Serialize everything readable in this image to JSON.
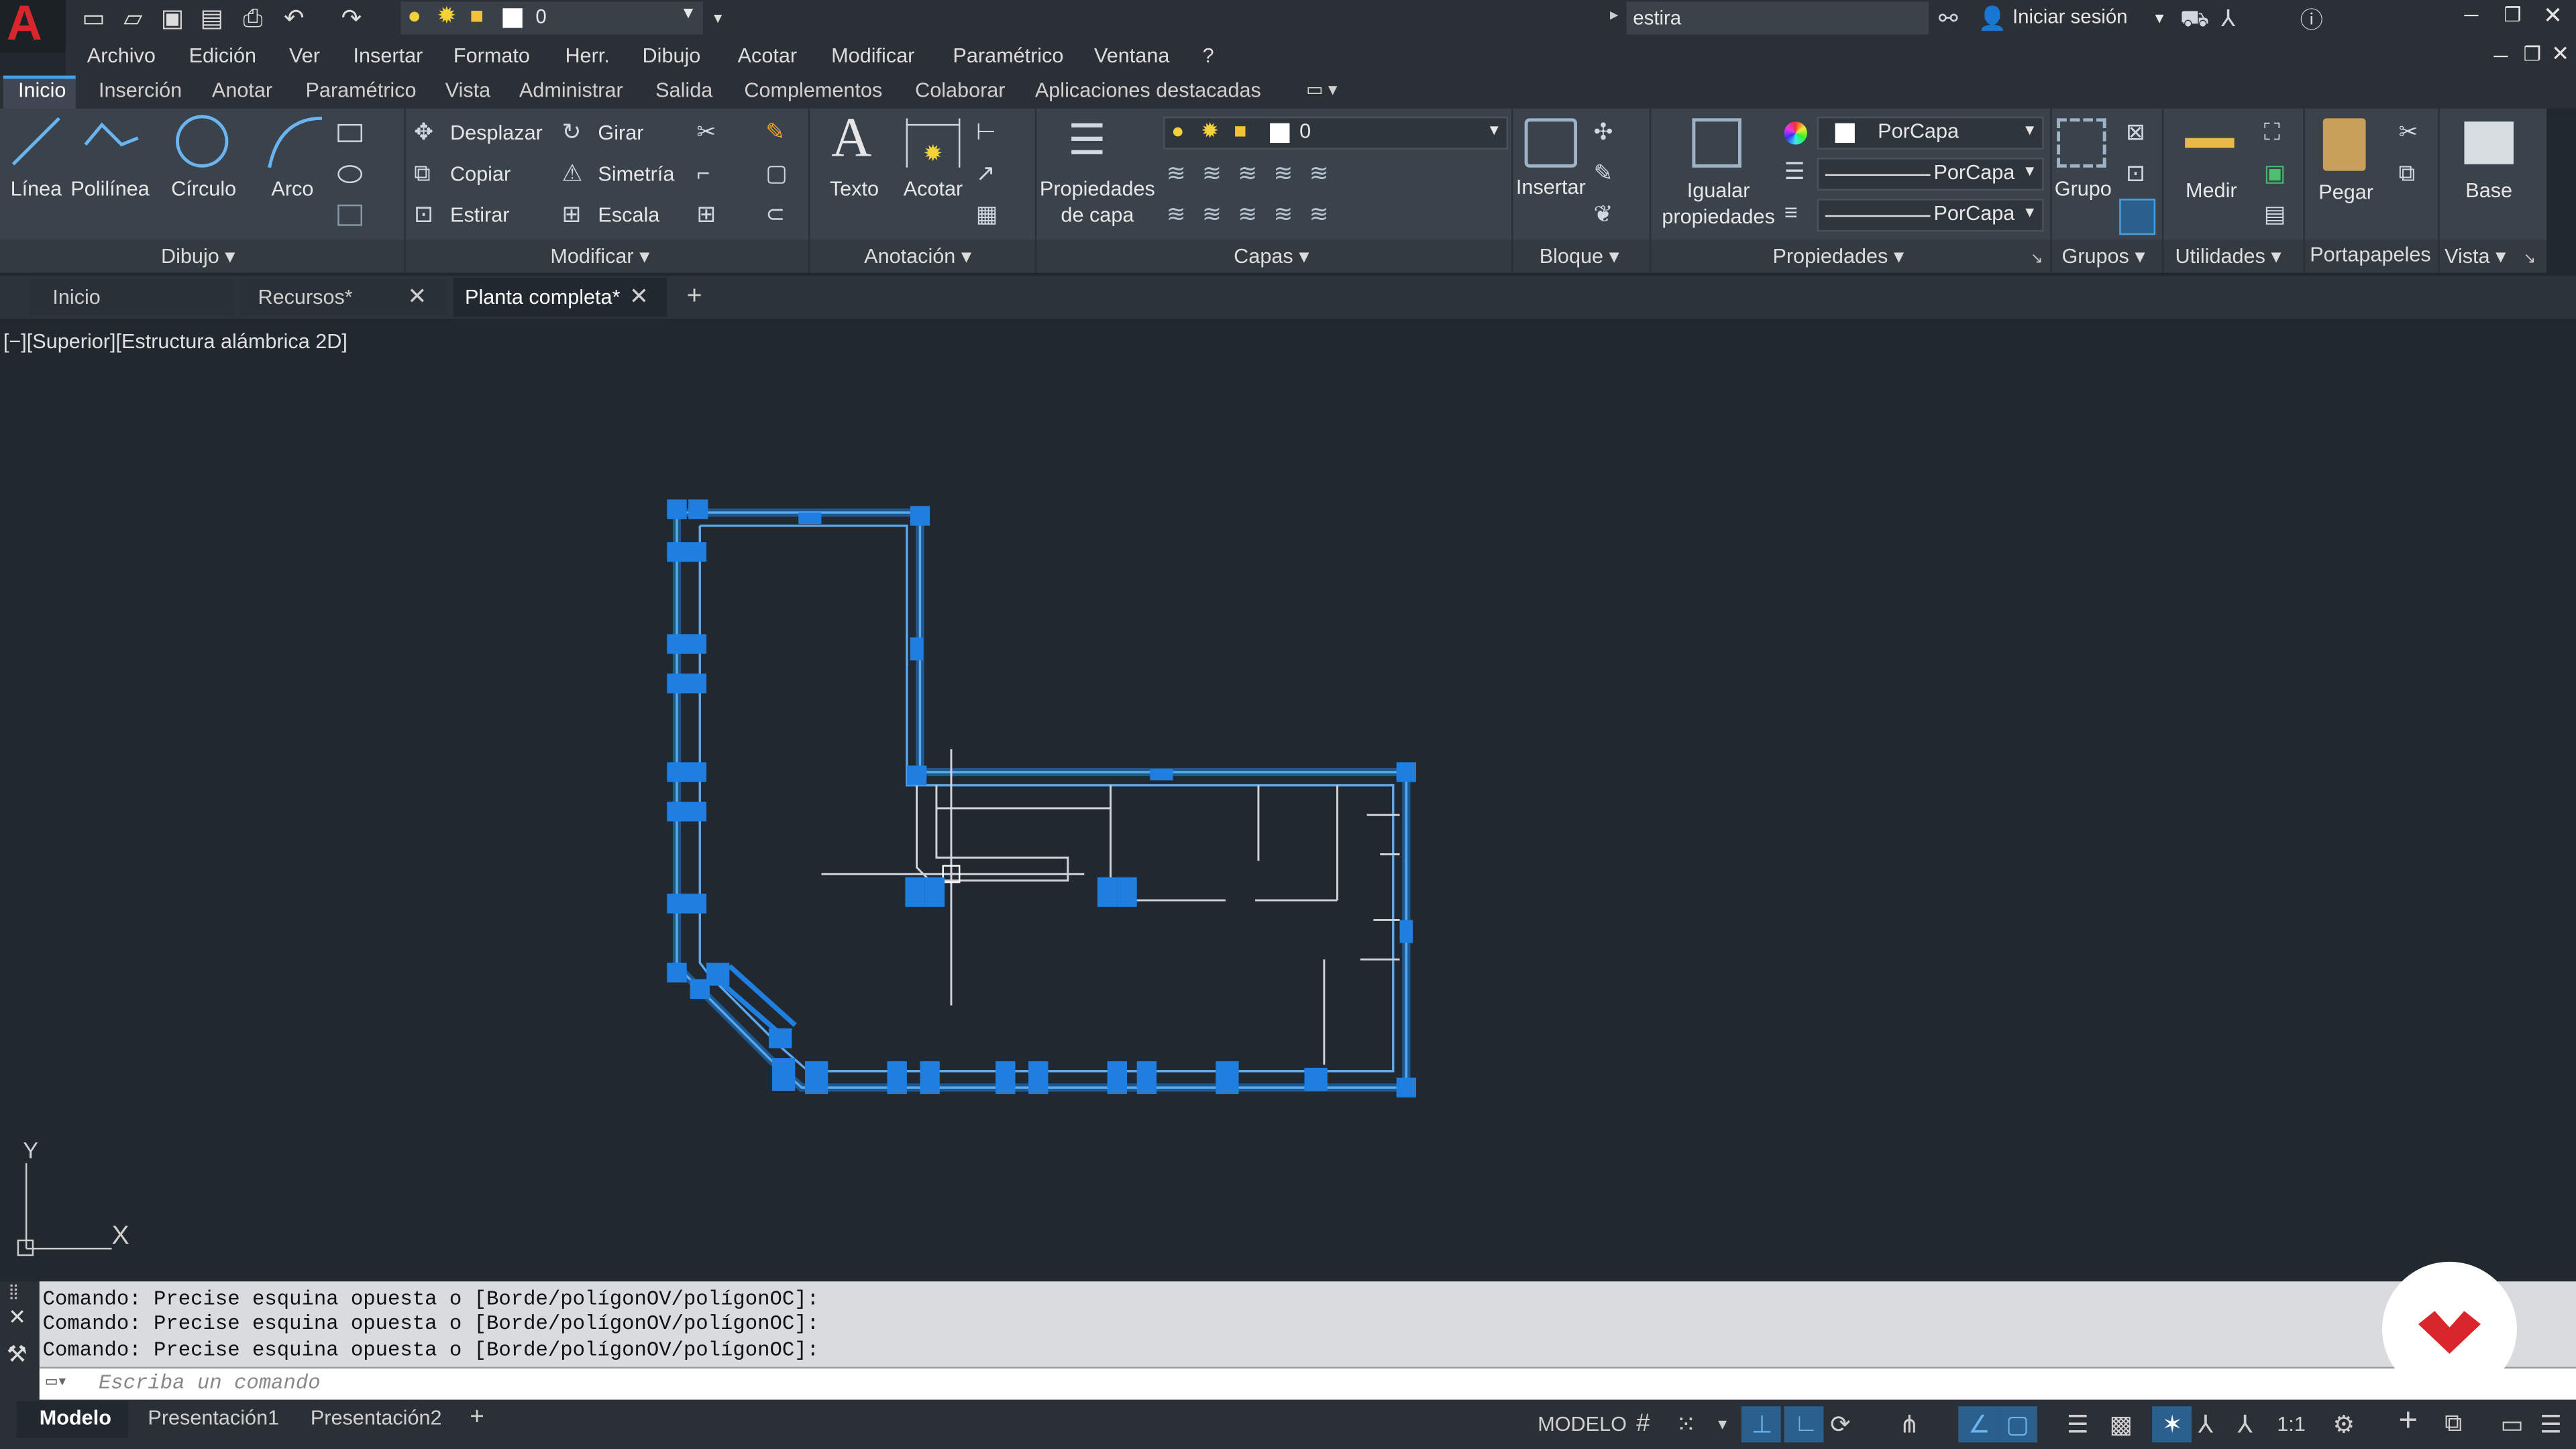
{
  "app": {
    "logo": "A",
    "layer_value": "0",
    "search_value": "estira",
    "signin": "Iniciar sesión"
  },
  "menu": [
    "Archivo",
    "Edición",
    "Ver",
    "Insertar",
    "Formato",
    "Herr.",
    "Dibujo",
    "Acotar",
    "Modificar",
    "Paramétrico",
    "Ventana",
    "?"
  ],
  "ribbon_tabs": [
    "Inicio",
    "Inserción",
    "Anotar",
    "Paramétrico",
    "Vista",
    "Administrar",
    "Salida",
    "Complementos",
    "Colaborar",
    "Aplicaciones destacadas"
  ],
  "ribbon": {
    "dibujo": {
      "tools": [
        "Línea",
        "Polilínea",
        "Círculo",
        "Arco"
      ],
      "label": "Dibujo"
    },
    "modificar": {
      "tools": [
        "Desplazar",
        "Girar",
        "Copiar",
        "Simetría",
        "Estirar",
        "Escala"
      ],
      "label": "Modificar"
    },
    "anotacion": {
      "texto": "Texto",
      "acotar": "Acotar",
      "label": "Anotación"
    },
    "capas": {
      "prop_line1": "Propiedades",
      "prop_line2": "de capa",
      "layer": "0",
      "label": "Capas"
    },
    "bloque": {
      "insertar": "Insertar",
      "label": "Bloque"
    },
    "propiedades": {
      "igualar1": "Igualar",
      "igualar2": "propiedades",
      "color": "PorCapa",
      "linetype": "PorCapa",
      "lineweight": "PorCapa",
      "label": "Propiedades"
    },
    "grupos": {
      "grupo": "Grupo",
      "label": "Grupos"
    },
    "utilidades": {
      "medir": "Medir",
      "label": "Utilidades"
    },
    "portapapeles": {
      "pegar": "Pegar",
      "label": "Portapapeles"
    },
    "vista": {
      "base": "Base",
      "label": "Vista"
    }
  },
  "doc_tabs": [
    "Inicio",
    "Recursos*",
    "Planta completa*"
  ],
  "viewport_label": "[−][Superior][Estructura alámbrica 2D]",
  "ucs": {
    "x": "X",
    "y": "Y"
  },
  "command": {
    "history": [
      "Comando: Precise esquina opuesta o [Borde/polígonOV/polígonOC]:",
      "Comando: Precise esquina opuesta o [Borde/polígonOV/polígonOC]:",
      "Comando: Precise esquina opuesta o [Borde/polígonOV/polígonOC]:"
    ],
    "placeholder": "Escriba un comando"
  },
  "layout_tabs": [
    "Modelo",
    "Presentación1",
    "Presentación2"
  ],
  "status": {
    "mode": "MODELO",
    "scale": "1:1"
  },
  "colors": {
    "accent": "#1e7fe0",
    "bg": "#212830",
    "logo": "#d9262c"
  }
}
